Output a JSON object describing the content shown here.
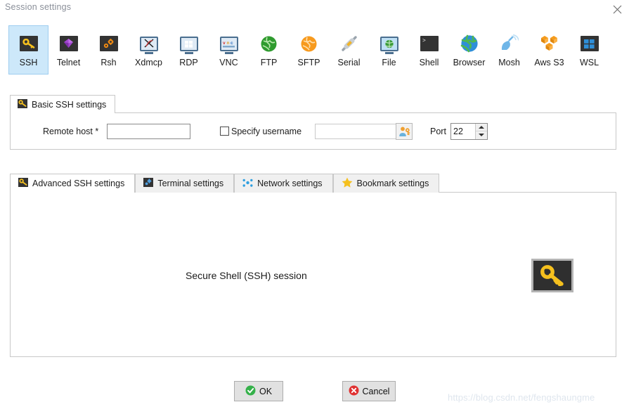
{
  "window": {
    "title": "Session settings",
    "close_icon": "close-x-icon"
  },
  "protocols": {
    "selected": "SSH",
    "items": [
      {
        "label": "SSH",
        "icon": "key-icon"
      },
      {
        "label": "Telnet",
        "icon": "purple-gem-icon"
      },
      {
        "label": "Rsh",
        "icon": "orange-gears-icon"
      },
      {
        "label": "Xdmcp",
        "icon": "monitor-x-logo-icon"
      },
      {
        "label": "RDP",
        "icon": "monitor-windows-icon"
      },
      {
        "label": "VNC",
        "icon": "monitor-vnc-icon"
      },
      {
        "label": "FTP",
        "icon": "green-globe-icon"
      },
      {
        "label": "SFTP",
        "icon": "orange-globe-icon"
      },
      {
        "label": "Serial",
        "icon": "serial-connector-icon"
      },
      {
        "label": "File",
        "icon": "monitor-globe-icon"
      },
      {
        "label": "Shell",
        "icon": "terminal-prompt-icon"
      },
      {
        "label": "Browser",
        "icon": "blue-globe-icon"
      },
      {
        "label": "Mosh",
        "icon": "satellite-dish-icon"
      },
      {
        "label": "Aws S3",
        "icon": "aws-cubes-icon"
      },
      {
        "label": "WSL",
        "icon": "windows-tiles-icon"
      }
    ]
  },
  "basic_group": {
    "tab_label": "Basic SSH settings",
    "tab_icon": "key-icon",
    "remote_host_label": "Remote host *",
    "remote_host_value": "",
    "remote_host_placeholder": "",
    "specify_username_label": "Specify username",
    "specify_username_checked": false,
    "username_value": "",
    "username_placeholder": "",
    "user_button_icon": "user-key-icon",
    "port_label": "Port",
    "port_value": "22",
    "spinner_up_icon": "triangle-up-icon",
    "spinner_down_icon": "triangle-down-icon"
  },
  "lower_tabs": {
    "active": "Advanced SSH settings",
    "items": [
      {
        "label": "Advanced SSH settings",
        "icon": "key-icon"
      },
      {
        "label": "Terminal settings",
        "icon": "blue-gear-icon"
      },
      {
        "label": "Network settings",
        "icon": "blue-dots-icon"
      },
      {
        "label": "Bookmark settings",
        "icon": "yellow-star-icon"
      }
    ]
  },
  "panel": {
    "caption": "Secure Shell (SSH) session",
    "big_icon": "large-key-icon"
  },
  "buttons": {
    "ok_label": "OK",
    "ok_icon": "green-check-circle-icon",
    "cancel_label": "Cancel",
    "cancel_icon": "red-x-circle-icon"
  },
  "watermark": {
    "text": "https://blog.csdn.net/fengshaungme"
  },
  "colors": {
    "selected_tile_bg": "#cde8fa",
    "selected_tile_border": "#9ecdf0",
    "border_gray": "#c8c8c8",
    "tab_inactive_bg": "#f0f0f0",
    "button_bg": "#e1e1e1",
    "key_gold": "#f5c01e",
    "ok_green": "#35b14a",
    "cancel_red": "#e03131",
    "title_gray": "#8a8f99",
    "watermark": "#dfe6ee"
  }
}
